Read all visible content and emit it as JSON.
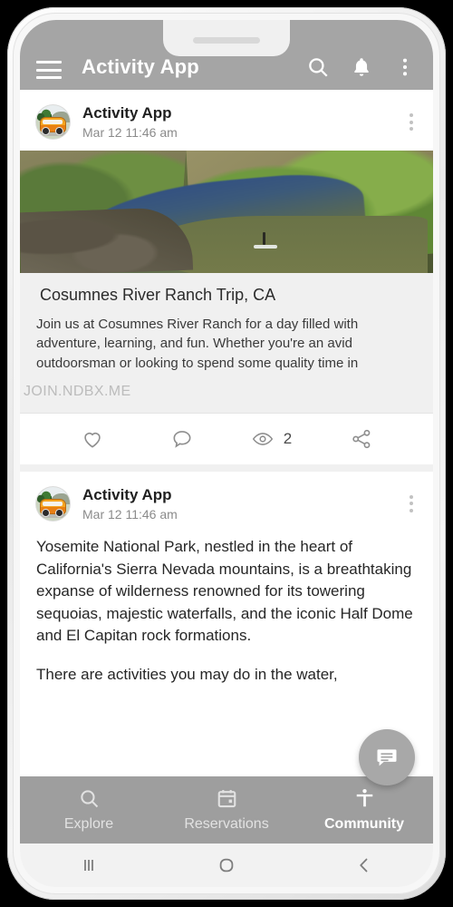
{
  "appbar": {
    "title": "Activity App",
    "menu_icon": "hamburger-menu-icon",
    "search_icon": "search-icon",
    "notifications_icon": "bell-icon",
    "overflow_icon": "more-vertical-icon"
  },
  "posts": [
    {
      "author": "Activity App",
      "timestamp": "Mar 12 11:46 am",
      "avatar_icon": "camper-van-avatar",
      "more_icon": "more-vertical-icon",
      "link_card": {
        "image_alt": "river-photo",
        "title": "Cosumnes River Ranch Trip, CA",
        "description": "Join us at Cosumnes River Ranch for a day filled with adventure, learning, and fun. Whether you're an avid outdoorsman or looking to spend some quality time in",
        "domain": "JOIN.NDBX.ME"
      },
      "actions": {
        "like_icon": "heart-icon",
        "comment_icon": "comment-icon",
        "view_icon": "eye-icon",
        "view_count": "2",
        "share_icon": "share-icon"
      }
    },
    {
      "author": "Activity App",
      "timestamp": "Mar 12 11:46 am",
      "avatar_icon": "camper-van-avatar",
      "more_icon": "more-vertical-icon",
      "paragraph_1": "Yosemite National Park, nestled in the heart of California's Sierra Nevada mountains, is a breathtaking expanse of wilderness renowned for its towering sequoias, majestic waterfalls, and the iconic Half Dome and El Capitan rock formations.",
      "paragraph_2": "There are activities you may do in the water,"
    }
  ],
  "fab": {
    "icon": "chat-message-icon"
  },
  "bottom_nav": {
    "items": [
      {
        "label": "Explore",
        "icon": "search-icon",
        "active": false
      },
      {
        "label": "Reservations",
        "icon": "calendar-icon",
        "active": false
      },
      {
        "label": "Community",
        "icon": "accessibility-person-icon",
        "active": true
      }
    ]
  },
  "system_nav": {
    "recents_icon": "recents-bars-icon",
    "home_icon": "home-circle-icon",
    "back_icon": "back-chevron-icon"
  },
  "colors": {
    "appbar": "#a5a5a5",
    "bottom_nav": "#9e9e9e",
    "card_bg": "#f0f0f0",
    "fab": "#a8a8a8"
  }
}
